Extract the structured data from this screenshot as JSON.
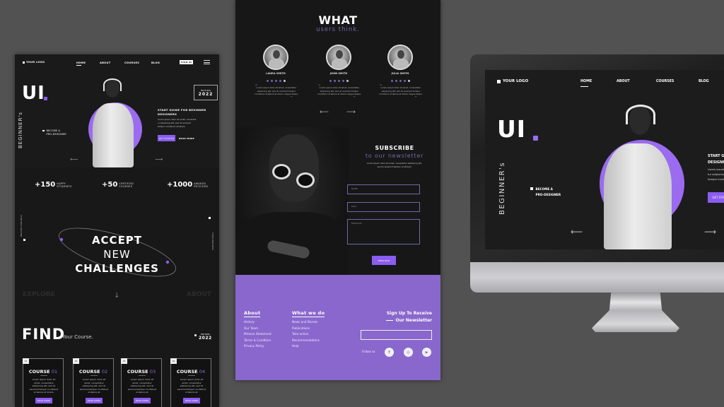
{
  "background_color": "#525252",
  "accent_color": "#8a5df0",
  "panel1": {
    "nav": {
      "logo": "YOUR LOGO",
      "items": [
        "HOME",
        "ABOUT",
        "COURSES",
        "BLOG"
      ],
      "signin": "SIGN IN"
    },
    "hero": {
      "title": "UI",
      "vertical_text": "BEGINNER's",
      "bullet": [
        "BECOME A",
        "PRO-DESIGNER"
      ],
      "edition_label": "EDITION",
      "edition_year": "2022",
      "heading": [
        "START GUIDE FOR BEGINNER",
        "DESIGNERS"
      ],
      "description": [
        "Lorem ipsum dolor sit amet, consectet-",
        "ur adipiscing elit, sed do eiusmod",
        "tempor incididunt ut labore."
      ],
      "cta": "GET STARTED",
      "read_more": "READ MORE"
    },
    "stats": [
      {
        "number": "+150",
        "label": [
          "HAPPY",
          "STUDENTS"
        ]
      },
      {
        "number": "+50",
        "label": [
          "CERTIFIED",
          "COURSES"
        ]
      },
      {
        "number": "+1000",
        "label": [
          "AWARDS",
          "RECEIVED"
        ]
      }
    ],
    "challenge": {
      "line1": "ACCEPT",
      "line2": "NEW",
      "line3": "CHALLENGES",
      "left_side": "EXPLORE",
      "right_side": "ABOUT",
      "side_vertical_left": "DISCOVER YOUR SKILLS",
      "side_vertical_right": "STUDY NEW SKILLS"
    },
    "find": {
      "title": "FIND",
      "subtitle": "Your Course.",
      "edition_label": "EDITION",
      "edition_year": "2022"
    },
    "courses": [
      {
        "tag": "01",
        "label": "COURSE",
        "num": "01",
        "desc": "Lorem ipsum dolor sit amet, consectetur adipiscing elit, sed do eiusmod tempor incididunt ut labore et dolore.",
        "button": "READ MORE"
      },
      {
        "tag": "02",
        "label": "COURSE",
        "num": "02",
        "desc": "Lorem ipsum dolor sit amet, consectetur adipiscing elit, sed do eiusmod tempor incididunt ut labore et.",
        "button": "READ MORE"
      },
      {
        "tag": "03",
        "label": "COURSE",
        "num": "03",
        "desc": "Lorem ipsum dolor sit amet, consectetur adipiscing elit, sed do eiusmod tempor incididunt ut labore et.",
        "button": "READ MORE"
      },
      {
        "tag": "04",
        "label": "COURSE",
        "num": "04",
        "desc": "Lorem ipsum dolor sit amet, consectetur adipiscing elit, sed do eiusmod tempor incididunt ut labore et.",
        "button": "READ MORE"
      }
    ]
  },
  "panel2": {
    "heading": "WHAT",
    "subheading": "users think.",
    "testimonials": [
      {
        "name": "LAURA SMITH",
        "rating": 4,
        "quote": "Lorem ipsum dolor sit amet, consectetur adipiscing elit, sed do eiusmod tempor incididunt ut labore et dolore magna aliqua."
      },
      {
        "name": "JOHN SMITH",
        "rating": 4,
        "quote": "Lorem ipsum dolor sit amet, consectetur adipiscing elit, sed do eiusmod tempor incididunt ut labore et dolore magna aliqua."
      },
      {
        "name": "JULIA SMITH",
        "rating": 4,
        "quote": "Lorem ipsum dolor sit amet, consectetur adipiscing elit, sed do eiusmod tempor incididunt ut labore et dolore magna aliqua."
      }
    ],
    "subscribe": {
      "title": "SUBSCRIBE",
      "subtitle": "to our newsletter",
      "description": [
        "Lorem ipsum dolor sit amet, consectetur adipiscing elit,",
        "sed do eiusmod tempor incididunt."
      ],
      "name_placeholder": "NAME",
      "mail_placeholder": "MAIL",
      "message_placeholder": "MESSAGE",
      "button": "SEND NOW"
    },
    "footer": {
      "about_title": "About",
      "about_links": [
        "History",
        "Our Team",
        "Mission Statement",
        "Terms & Condition",
        "Privacy Policy"
      ],
      "whatwedo_title": "What we do",
      "whatwedo_links": [
        "News and Stories",
        "Publications",
        "Take action",
        "Recommendations",
        "Help"
      ],
      "signup_line1": "Sign Up To Receive",
      "signup_line2": "Our Newsletter",
      "follow": "Follow us",
      "socials": [
        "f",
        "◎",
        "▶"
      ]
    }
  },
  "monitor": {
    "nav": {
      "logo": "YOUR LOGO",
      "items": [
        "HOME",
        "ABOUT",
        "COURSES",
        "BLOG"
      ]
    },
    "hero": {
      "title": "UI",
      "vertical_text": "BEGINNER's",
      "bullet": [
        "BECOME A",
        "PRO-DESIGNER"
      ],
      "heading": [
        "START GUIDE FOR BEGINNER",
        "DESIGNERS"
      ],
      "description": [
        "Lorem ipsum dolor sit amet,",
        "tur adipiscing elit, sed do",
        "tempor incididunt ut labore."
      ],
      "cta": "GET STARTED"
    }
  }
}
